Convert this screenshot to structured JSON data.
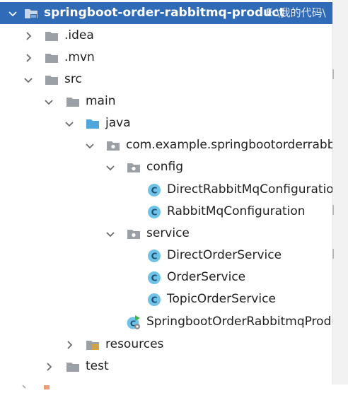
{
  "project": {
    "name": "springboot-order-rabbitmq-product",
    "path": "E:\\我的代码\\"
  },
  "tree": {
    "idea": ".idea",
    "mvn": ".mvn",
    "src": "src",
    "main": "main",
    "java": "java",
    "package": "com.example.springbootorderrabbitmqproduct",
    "config": "config",
    "direct_config": "DirectRabbitMqConfiguration",
    "rabbit_config": "RabbitMqConfiguration",
    "service": "service",
    "direct_service": "DirectOrderService",
    "order_service": "OrderService",
    "topic_service": "TopicOrderService",
    "app_class": "SpringbootOrderRabbitmqProductApplication",
    "resources": "resources",
    "test": "test"
  },
  "colors": {
    "selection": "#2f6bb7",
    "folder_gray": "#9aa0a6",
    "source_blue": "#4ea6dc",
    "class_circle": "#6fc3e8",
    "run_green": "#3bb54a"
  }
}
